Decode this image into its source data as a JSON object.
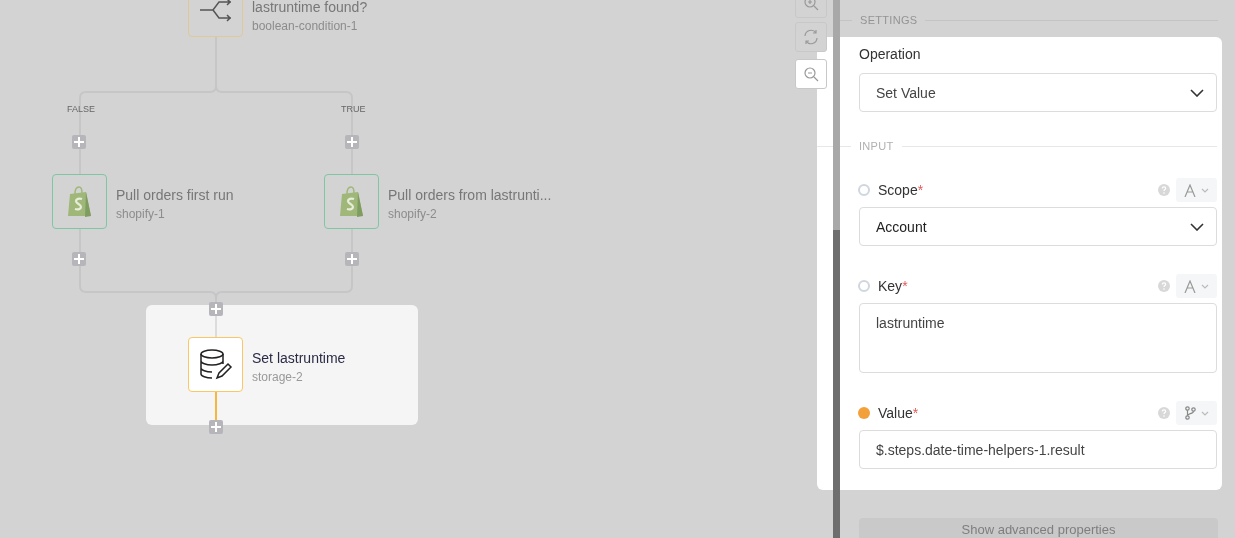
{
  "canvas": {
    "nodes": [
      {
        "kind": "condition",
        "title": "lastruntime found?",
        "subtitle": "boolean-condition-1",
        "highlighted": false
      },
      {
        "kind": "shopify",
        "title": "Pull orders first run",
        "subtitle": "shopify-1",
        "highlighted": false
      },
      {
        "kind": "shopify",
        "title": "Pull orders from lastrunti...",
        "subtitle": "shopify-2",
        "highlighted": false
      },
      {
        "kind": "storage",
        "title": "Set lastruntime",
        "subtitle": "storage-2",
        "highlighted": true
      }
    ],
    "branches": [
      {
        "label": "FALSE"
      },
      {
        "label": "TRUE"
      }
    ]
  },
  "panel": {
    "settings_label": "SETTINGS",
    "operation": {
      "label": "Operation",
      "value": "Set Value"
    },
    "input_label": "INPUT",
    "fields": [
      {
        "kind": "select",
        "label": "Scope",
        "required": true,
        "required_mark": "*",
        "mapped": false,
        "value": "Account"
      },
      {
        "kind": "textarea",
        "label": "Key",
        "required": true,
        "required_mark": "*",
        "mapped": false,
        "value": "lastruntime"
      },
      {
        "kind": "input",
        "label": "Value",
        "required": true,
        "required_mark": "*",
        "mapped": true,
        "value": "$.steps.date-time-helpers-1.result"
      }
    ],
    "advanced_button": "Show advanced properties"
  }
}
